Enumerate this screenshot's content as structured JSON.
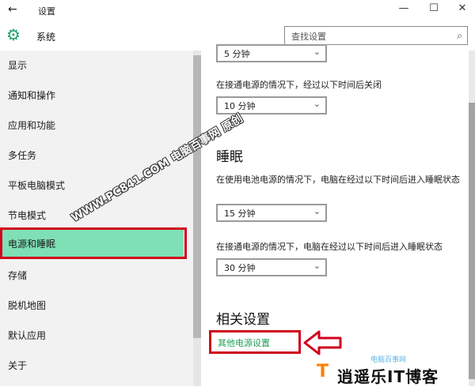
{
  "window": {
    "title": "设置",
    "back_icon": "←",
    "min_icon": "—",
    "max_icon": "☐",
    "close_icon": "✕"
  },
  "header": {
    "title": "系统",
    "gear_icon": "⚙",
    "search_placeholder": "查找设置",
    "search_icon": "⌕"
  },
  "sidebar": {
    "items": [
      {
        "label": "显示"
      },
      {
        "label": "通知和操作"
      },
      {
        "label": "应用和功能"
      },
      {
        "label": "多任务"
      },
      {
        "label": "平板电脑模式"
      },
      {
        "label": "节电模式"
      },
      {
        "label": "电源和睡眠",
        "selected": true
      },
      {
        "label": "存储"
      },
      {
        "label": "脱机地图"
      },
      {
        "label": "默认应用"
      },
      {
        "label": "关于"
      }
    ]
  },
  "content": {
    "screen_prev_value": "5 分钟",
    "screen_plugged_desc": "在接通电源的情况下，经过以下时间后关闭",
    "screen_plugged_value": "10 分钟",
    "sleep_title": "睡眠",
    "sleep_battery_desc": "在使用电池电源的情况下，电脑在经过以下时间后进入睡眠状态",
    "sleep_battery_value": "15 分钟",
    "sleep_plugged_desc": "在接通电源的情况下，电脑在经过以下时间后进入睡眠状态",
    "sleep_plugged_value": "30 分钟",
    "related_title": "相关设置",
    "other_power_link": "其他电源设置",
    "chevron": "⌄"
  },
  "overlay": {
    "watermark": "WWW.PC841.COM 电脑百事网 原创",
    "logo_small": "电脑百事网",
    "logo_text": "逍遥乐IT博客",
    "logo_icon": "T"
  },
  "colors": {
    "accent": "#1ea36c",
    "selected_bg": "#7fe0b5",
    "highlight_red": "#d0021b",
    "link_green": "#1f9d55"
  }
}
